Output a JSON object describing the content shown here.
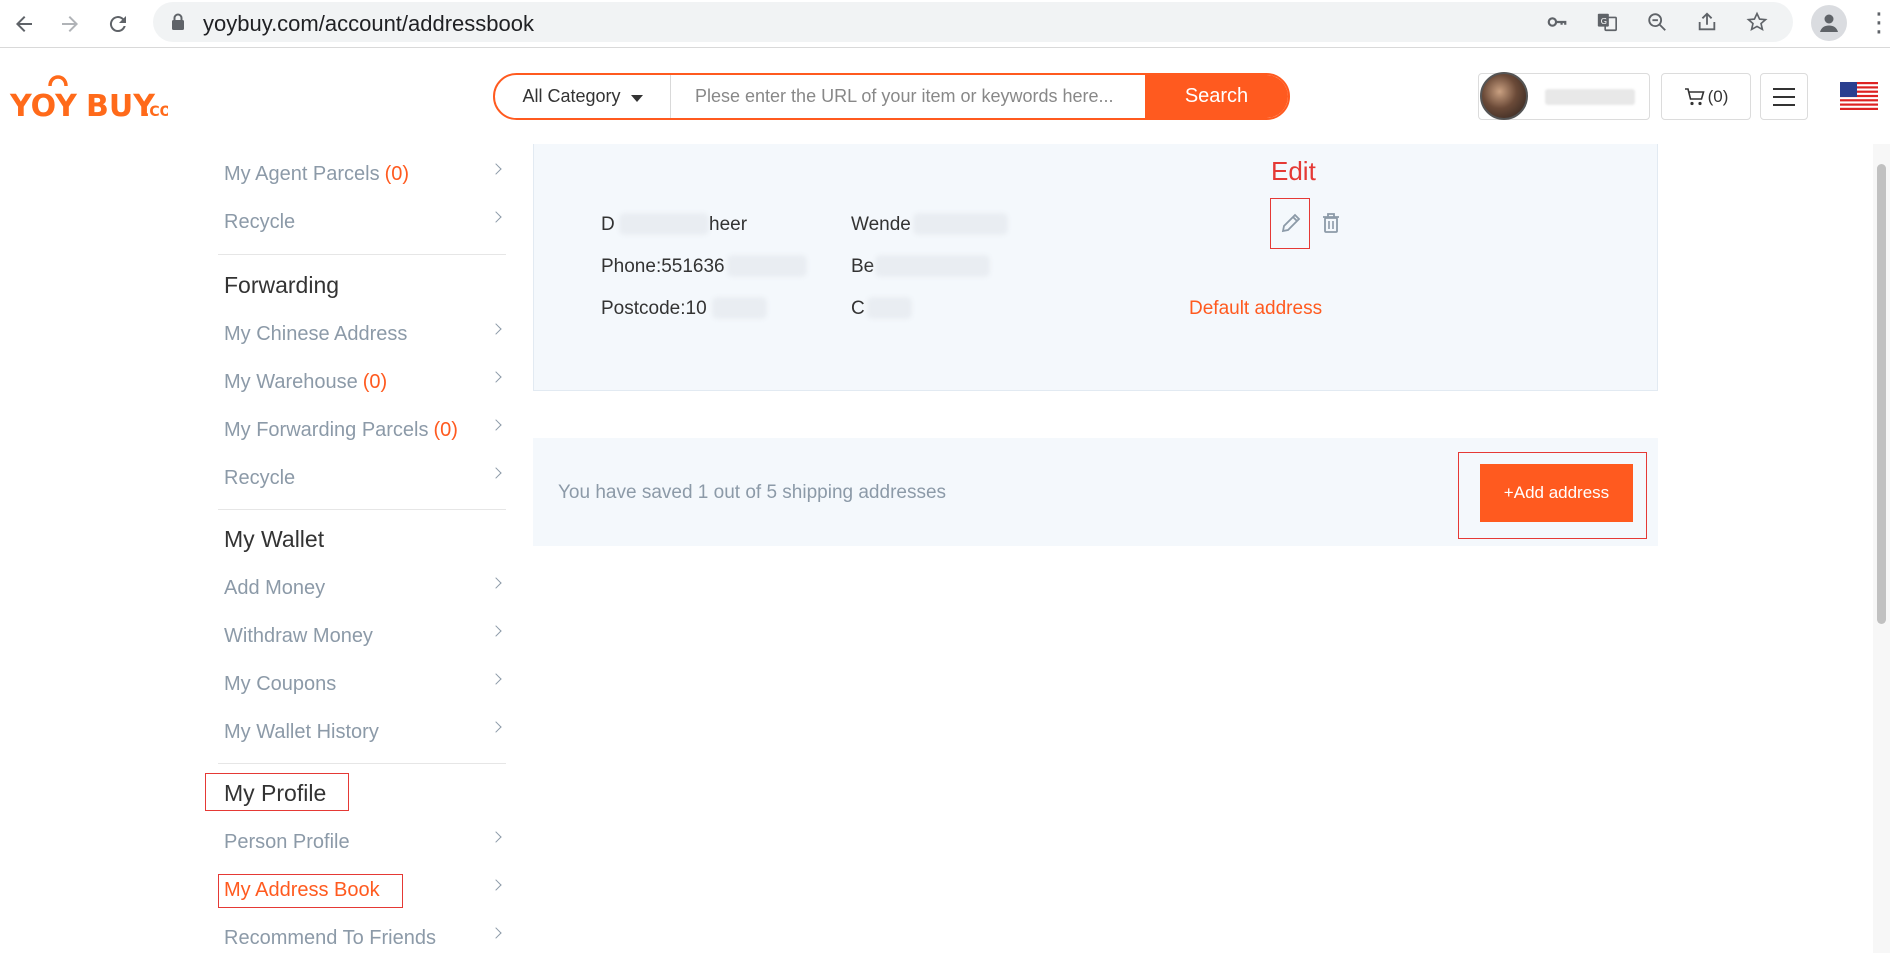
{
  "browser": {
    "url": "yoybuy.com/account/addressbook"
  },
  "header": {
    "logo_text": "YOYBUY.COM",
    "category_label": "All Category",
    "search_placeholder": "Plese enter the URL of your item or keywords here...",
    "search_button": "Search",
    "cart_count": "(0)"
  },
  "sidebar": {
    "top_items": [
      {
        "label": "My Agent Parcels",
        "count": "(0)"
      },
      {
        "label": "Recycle",
        "count": ""
      }
    ],
    "forwarding": {
      "heading": "Forwarding",
      "items": [
        {
          "label": "My Chinese Address",
          "count": ""
        },
        {
          "label": "My Warehouse",
          "count": "(0)"
        },
        {
          "label": "My Forwarding Parcels",
          "count": "(0)"
        },
        {
          "label": "Recycle",
          "count": ""
        }
      ]
    },
    "wallet": {
      "heading": "My Wallet",
      "items": [
        {
          "label": "Add Money"
        },
        {
          "label": "Withdraw Money"
        },
        {
          "label": "My Coupons"
        },
        {
          "label": "My Wallet History"
        }
      ]
    },
    "profile": {
      "heading": "My Profile",
      "items": [
        {
          "label": "Person Profile"
        },
        {
          "label": "My Address Book"
        },
        {
          "label": "Recommend To Friends"
        }
      ]
    }
  },
  "address_card": {
    "name_visible_start": "D",
    "name_visible_end": "heer",
    "phone": "Phone:551636",
    "postcode": "Postcode:10",
    "col2_line1": "Wende",
    "col2_line2": "Be",
    "col2_line3": "C",
    "default_label": "Default address",
    "edit_annotation": "Edit"
  },
  "save_bar": {
    "message": "You have saved 1 out of 5 shipping addresses",
    "add_button": "+Add address"
  },
  "colors": {
    "brand": "#ff5a1f",
    "annotation": "#e53935",
    "muted_text": "#8c9aa8",
    "card_bg": "#f4f8fc"
  }
}
